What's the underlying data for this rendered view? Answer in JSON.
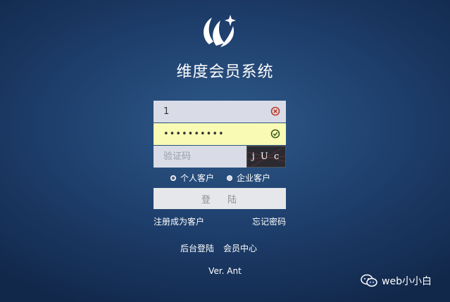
{
  "app": {
    "title": "维度会员系统",
    "version": "Ver. Ant"
  },
  "form": {
    "username_value": "1",
    "password_value": "••••••••••",
    "captcha_placeholder": "验证码",
    "captcha_text": "j U c n",
    "login_label": "登 陆"
  },
  "customer_type": {
    "options": [
      "个人客户",
      "企业客户"
    ],
    "selected": "个人客户"
  },
  "links": {
    "register": "注册成为客户",
    "forgot": "忘记密码",
    "admin": "后台登陆",
    "member_center": "会员中心"
  },
  "watermark": {
    "text": "web小小白"
  },
  "colors": {
    "background": "#1d3d6a",
    "error_icon": "#c0392b",
    "success_icon": "#3c5a1e",
    "password_fill": "#f9fbb4"
  }
}
